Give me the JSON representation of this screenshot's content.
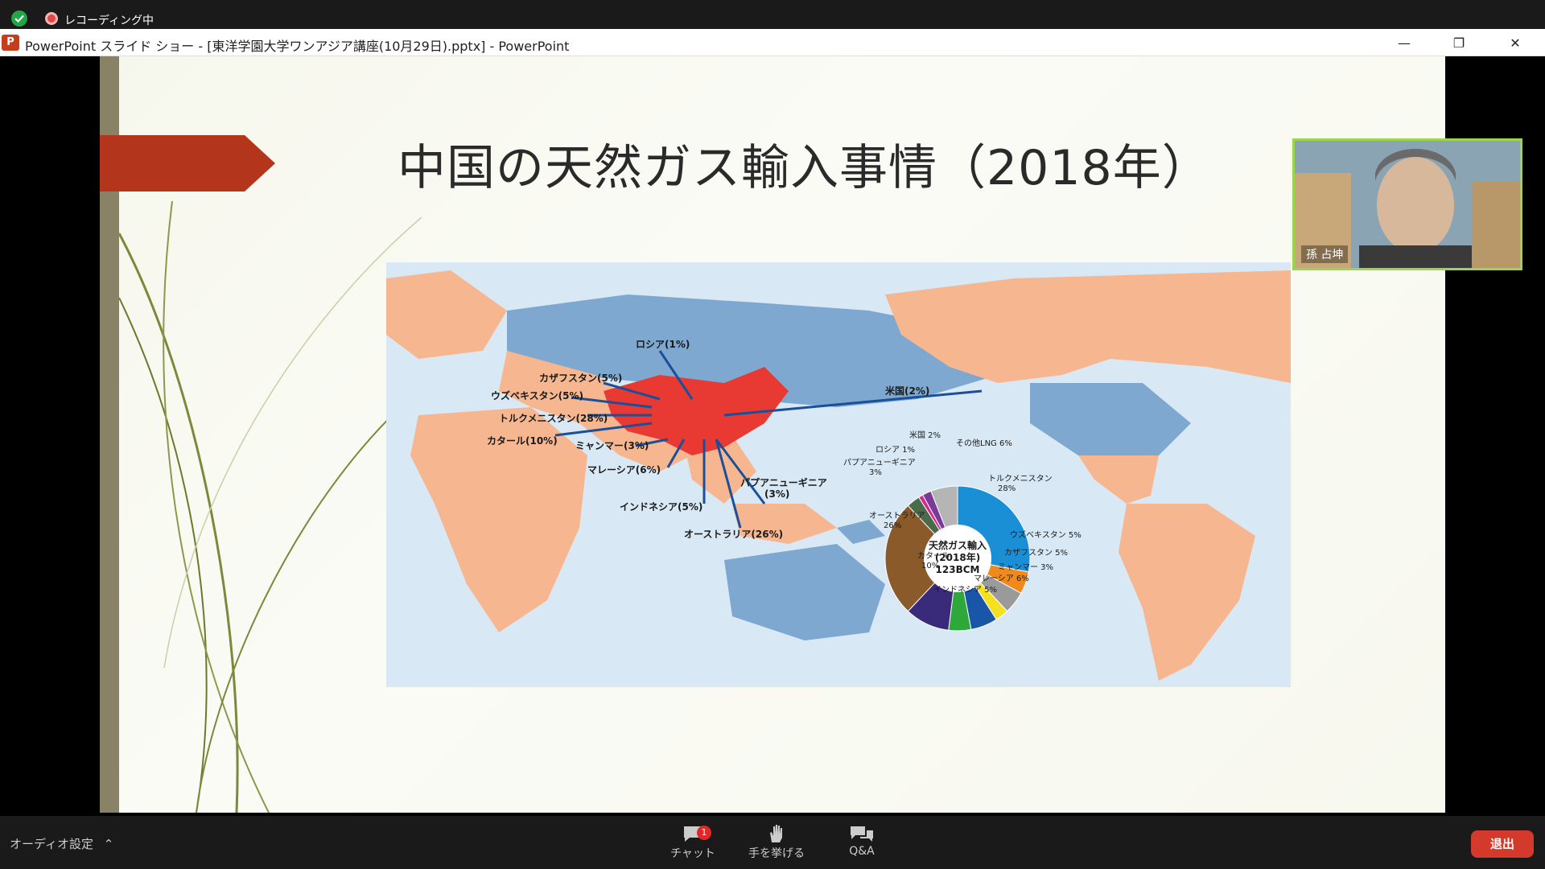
{
  "zoom_top": {
    "recording_label": "レコーディング中"
  },
  "ppt_window": {
    "title": "PowerPoint スライド ショー - [東洋学園大学ワンアジア講座(10月29日).pptx] - PowerPoint",
    "app_icon_letter": "P",
    "minimize": "—",
    "maximize": "❐",
    "close": "✕"
  },
  "slide": {
    "title": "中国の天然ガス輸入事情（2018年）",
    "map_labels": [
      "ロシア(1%)",
      "カザフスタン(5%)",
      "ウズベキスタン(5%)",
      "トルクメニスタン(28%)",
      "カタール(10%)",
      "ミャンマー(3%)",
      "マレーシア(6%)",
      "インドネシア(5%)",
      "オーストラリア(26%)",
      "パプアニューギニア",
      "(3%)",
      "米国(2%)"
    ],
    "pie_center": [
      "天然ガス輸入",
      "(2018年)",
      "123BCM"
    ],
    "pie_labels": [
      "米国 2%",
      "その他LNG 6%",
      "ロシア 1%",
      "パプアニューギニア",
      "3%",
      "トルクメニスタン",
      "28%",
      "オーストラリア",
      "26%",
      "ウズベキスタン 5%",
      "カザフスタン 5%",
      "ミャンマー 3%",
      "マレーシア 6%",
      "カタール",
      "10%",
      "インドネシア 5%"
    ]
  },
  "chart_data": {
    "type": "pie",
    "title": "天然ガス輸入 (2018年) 123BCM",
    "categories": [
      "トルクメニスタン",
      "ウズベキスタン",
      "カザフスタン",
      "ミャンマー",
      "マレーシア",
      "インドネシア",
      "カタール",
      "オーストラリア",
      "パプアニューギニア",
      "ロシア",
      "米国",
      "その他LNG"
    ],
    "values": [
      28,
      5,
      5,
      3,
      6,
      5,
      10,
      26,
      3,
      1,
      2,
      6
    ],
    "colors": [
      "#1a8fd6",
      "#f08a1c",
      "#9a9a9a",
      "#f5e021",
      "#1a56a8",
      "#2ea83a",
      "#3a2a7a",
      "#8a5a2a",
      "#4a6a4a",
      "#d02a8a",
      "#7a3a9a",
      "#b5b5b5"
    ]
  },
  "video": {
    "name": "孫 占坤"
  },
  "zoom_bottom": {
    "audio_label": "オーディオ設定",
    "chat_label": "チャット",
    "chat_badge": "1",
    "hand_label": "手を挙げる",
    "qa_label": "Q&A",
    "leave_label": "退出"
  }
}
